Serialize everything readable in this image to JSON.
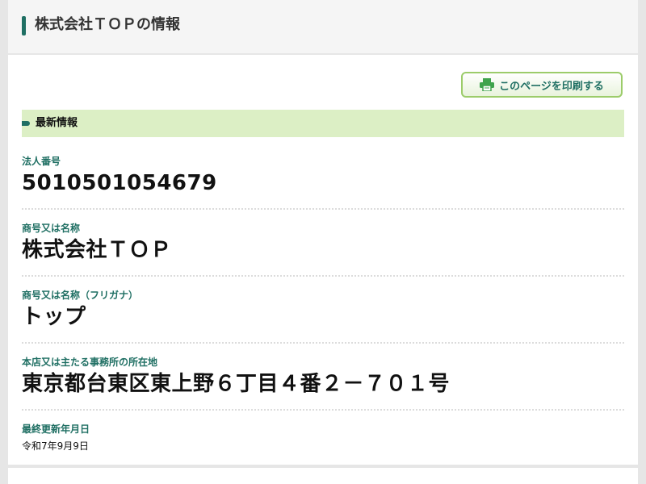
{
  "header": {
    "title": "株式会社ＴＯＰの情報"
  },
  "toolbar": {
    "print_label": "このページを印刷する",
    "print_icon": "printer-icon"
  },
  "section": {
    "title": "最新情報"
  },
  "fields": {
    "corporate_number": {
      "label": "法人番号",
      "value": "5010501054679"
    },
    "trade_name": {
      "label": "商号又は名称",
      "value": "株式会社ＴＯＰ"
    },
    "trade_name_kana": {
      "label": "商号又は名称（フリガナ）",
      "value": "トップ"
    },
    "address": {
      "label": "本店又は主たる事務所の所在地",
      "value": "東京都台東区東上野６丁目４番２－７０１号"
    },
    "last_updated": {
      "label": "最終更新年月日",
      "value": "令和7年9月9日"
    }
  },
  "colors": {
    "accent": "#1f6f63",
    "banner": "#dcefc5",
    "button_border": "#9ccc6a"
  }
}
